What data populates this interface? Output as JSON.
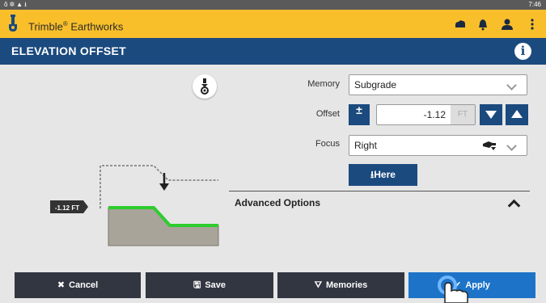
{
  "status_bar": {
    "time": "7:46",
    "icons": [
      "tool-icon",
      "settings-icon",
      "warning-icon",
      "download-icon"
    ]
  },
  "app_bar": {
    "title": "Trimble",
    "title_mark": "®",
    "title_suffix": " Earthworks",
    "icons": [
      "cloud-icon",
      "notification-icon",
      "user-icon",
      "more-icon"
    ],
    "color": "#f9bf2b"
  },
  "header": {
    "title": "ELEVATION OFFSET",
    "info_label": "i",
    "color": "#1b4a7e"
  },
  "form": {
    "memory_label": "Memory",
    "memory_value": "Subgrade",
    "offset_label": "Offset",
    "offset_value": "-1.12",
    "offset_unit": "FT",
    "plus_minus_label": "±",
    "focus_label": "Focus",
    "focus_value": "Right",
    "here_label": "Here"
  },
  "diagram": {
    "offset_tag": "-1.12 FT"
  },
  "advanced": {
    "title": "Advanced Options"
  },
  "bottom": {
    "cancel": "Cancel",
    "save": "Save",
    "memories": "Memories",
    "apply": "Apply"
  },
  "colors": {
    "primary": "#1b4a7e",
    "apply": "#1d73c8",
    "green": "#2ecc2e",
    "dark": "#323641"
  }
}
